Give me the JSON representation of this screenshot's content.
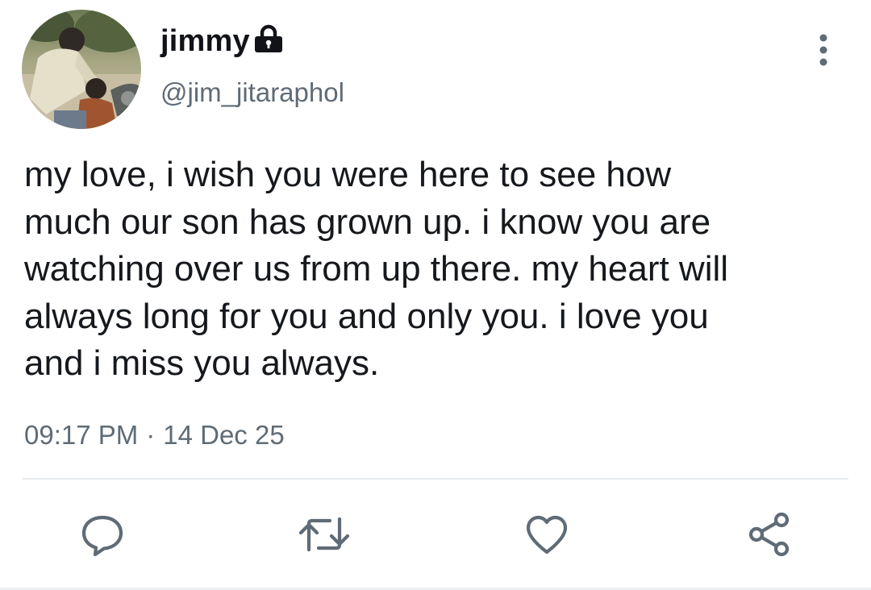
{
  "user": {
    "display_name": "jimmy",
    "handle": "@jim_jitaraphol",
    "protected_icon": "lock-icon",
    "avatar": "profile-photo"
  },
  "tweet": {
    "text": "my love, i wish you were here to see how\nmuch our son has grown up. i know you are\nwatching over us from up there. my heart will\nalways long for you and only you. i love you\nand i miss you always.",
    "time": "09:17 PM",
    "separator": "·",
    "date": "14 Dec 25"
  },
  "actions": [
    {
      "name": "reply",
      "icon": "comment-icon"
    },
    {
      "name": "retweet",
      "icon": "retweet-icon"
    },
    {
      "name": "like",
      "icon": "heart-icon"
    },
    {
      "name": "share",
      "icon": "share-icon"
    }
  ],
  "colors": {
    "text": "#15181c",
    "secondary_text": "#5f6b76",
    "icon": "#5f6b76",
    "divider": "#e6ebef",
    "background": "#ffffff"
  }
}
